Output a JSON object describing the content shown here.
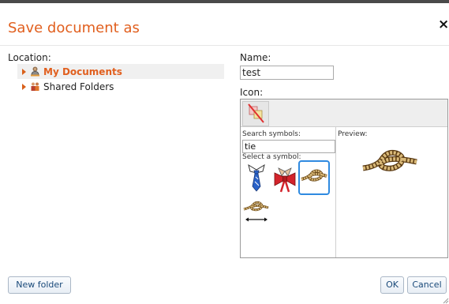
{
  "dialog": {
    "title": "Save document as",
    "close_glyph": "×"
  },
  "location": {
    "label": "Location:",
    "items": [
      {
        "label": "My Documents",
        "icon": "user-folder-icon",
        "selected": true
      },
      {
        "label": "Shared Folders",
        "icon": "shared-folder-icon",
        "selected": false
      }
    ]
  },
  "name": {
    "label": "Name:",
    "value": "test"
  },
  "icon": {
    "label": "Icon:",
    "no_icon_button": "no-icon",
    "search_label": "Search symbols:",
    "search_value": "tie",
    "select_label": "Select a symbol:",
    "preview_label": "Preview:",
    "symbols": [
      {
        "name": "necktie-symbol",
        "selected": false
      },
      {
        "name": "bow-tie-symbol",
        "selected": false
      },
      {
        "name": "rope-knot-symbol",
        "selected": true
      },
      {
        "name": "untie-knot-symbol",
        "selected": false
      }
    ]
  },
  "buttons": {
    "new_folder": "New folder",
    "ok": "OK",
    "cancel": "Cancel"
  },
  "colors": {
    "title": "#e15f1e",
    "accent_border": "#2f8ae0"
  }
}
